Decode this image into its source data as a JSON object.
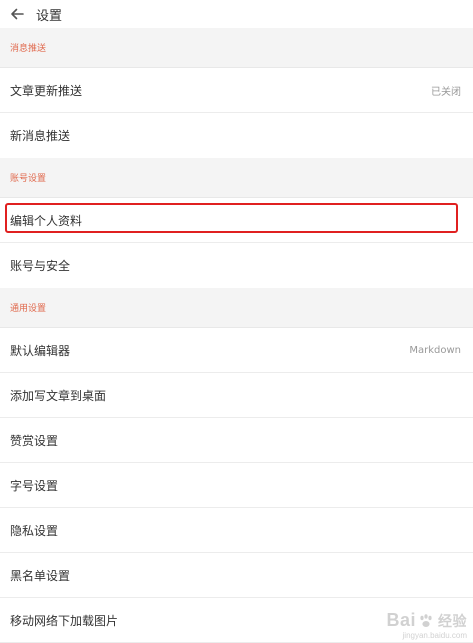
{
  "header": {
    "title": "设置",
    "back_icon": "arrow-left-icon"
  },
  "sections": [
    {
      "title": "消息推送",
      "items": [
        {
          "label": "文章更新推送",
          "value": "已关闭"
        },
        {
          "label": "新消息推送",
          "value": ""
        }
      ]
    },
    {
      "title": "账号设置",
      "items": [
        {
          "label": "编辑个人资料",
          "value": ""
        },
        {
          "label": "账号与安全",
          "value": ""
        }
      ]
    },
    {
      "title": "通用设置",
      "items": [
        {
          "label": "默认编辑器",
          "value": "Markdown"
        },
        {
          "label": "添加写文章到桌面",
          "value": ""
        },
        {
          "label": "赞赏设置",
          "value": ""
        },
        {
          "label": "字号设置",
          "value": ""
        },
        {
          "label": "隐私设置",
          "value": ""
        },
        {
          "label": "黑名单设置",
          "value": ""
        },
        {
          "label": "移动网络下加载图片",
          "value": ""
        }
      ]
    }
  ],
  "watermark": {
    "brand": "Bai",
    "brand_suffix": "经验",
    "url": "jingyan.baidu.com"
  },
  "colors": {
    "section_title": "#e0694d",
    "highlight": "#e02020",
    "section_bg": "#f4f4f4"
  }
}
